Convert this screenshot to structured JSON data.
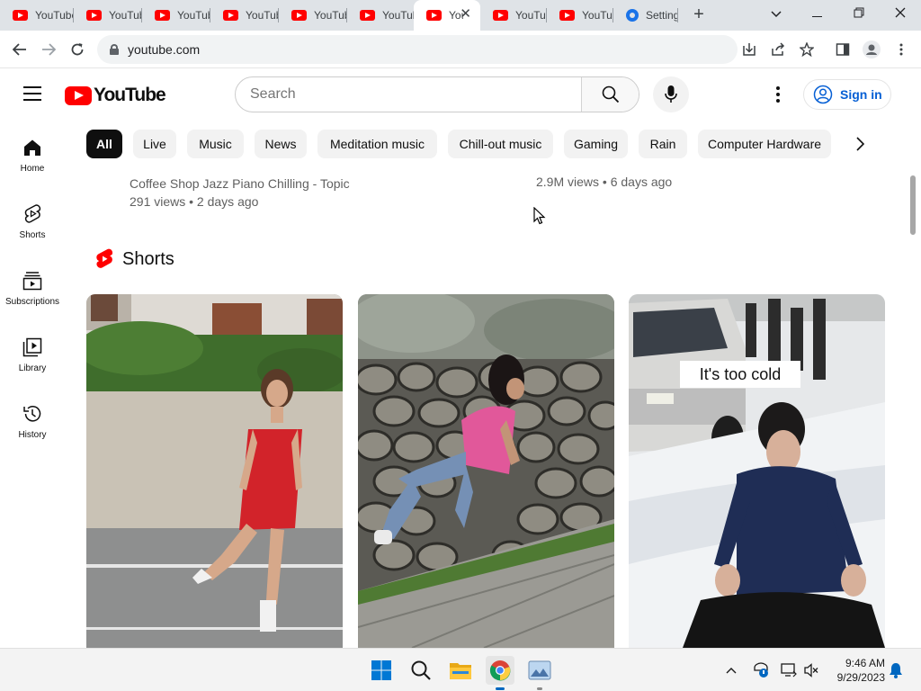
{
  "browser": {
    "tabs": [
      {
        "title": "YouTube",
        "icon": "youtube-favicon"
      },
      {
        "title": "YouTube",
        "icon": "youtube-favicon"
      },
      {
        "title": "YouTube",
        "icon": "youtube-favicon"
      },
      {
        "title": "YouTube",
        "icon": "youtube-favicon"
      },
      {
        "title": "YouTube",
        "icon": "youtube-favicon"
      },
      {
        "title": "YouTube",
        "icon": "youtube-favicon"
      },
      {
        "title": "YouTube",
        "icon": "youtube-favicon",
        "active": true
      },
      {
        "title": "YouTube",
        "icon": "youtube-favicon"
      },
      {
        "title": "YouTube",
        "icon": "youtube-favicon"
      },
      {
        "title": "Settings",
        "icon": "settings-gear-favicon"
      }
    ],
    "url": "youtube.com"
  },
  "youtube": {
    "logo_text": "YouTube",
    "search_placeholder": "Search",
    "signin_label": "Sign in",
    "guide": [
      {
        "label": "Home",
        "icon": "home-icon"
      },
      {
        "label": "Shorts",
        "icon": "shorts-icon"
      },
      {
        "label": "Subscriptions",
        "icon": "subscriptions-icon"
      },
      {
        "label": "Library",
        "icon": "library-icon"
      },
      {
        "label": "History",
        "icon": "history-icon"
      }
    ],
    "chips": [
      "All",
      "Live",
      "Music",
      "News",
      "Meditation music",
      "Chill-out music",
      "Gaming",
      "Rain",
      "Computer Hardware"
    ],
    "videos": [
      {
        "channel": "Coffee Shop Jazz Piano Chilling - Topic",
        "stats": "291 views • 2 days ago"
      },
      {
        "channel": "",
        "stats": "2.9M views • 6 days ago"
      }
    ],
    "shorts_title": "Shorts",
    "shorts": [
      {
        "thumbnail": "girl in red dress dancing on street"
      },
      {
        "thumbnail": "girl in pink shirt climbing stone wall"
      },
      {
        "thumbnail": "man kneeling in snow",
        "caption": "It's too cold"
      }
    ]
  },
  "taskbar": {
    "time": "9:46 AM",
    "date": "9/29/2023"
  }
}
